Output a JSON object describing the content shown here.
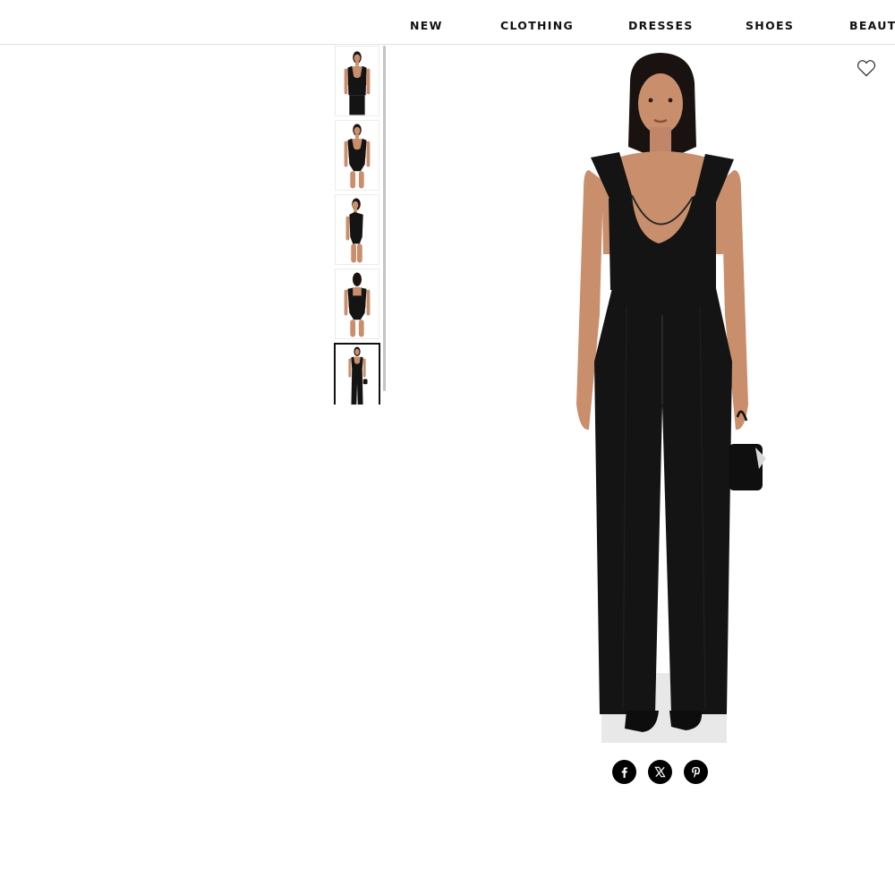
{
  "nav": {
    "items": [
      {
        "label": "NEW"
      },
      {
        "label": "CLOTHING"
      },
      {
        "label": "DRESSES"
      },
      {
        "label": "SHOES"
      },
      {
        "label": "BEAUTY"
      }
    ]
  },
  "gallery": {
    "thumbnails": [
      {
        "view": "front-upper",
        "selected": false
      },
      {
        "view": "front-bodysuit",
        "selected": false
      },
      {
        "view": "side-bodysuit",
        "selected": false
      },
      {
        "view": "back-bodysuit",
        "selected": false
      },
      {
        "view": "full-look",
        "selected": true
      }
    ],
    "main_image": {
      "icon": "product-photo"
    }
  },
  "actions": {
    "wishlist_icon": "heart-outline-icon"
  },
  "share": {
    "icons": [
      "facebook-icon",
      "x-icon",
      "pinterest-icon"
    ]
  },
  "colors": {
    "accent": "#111111",
    "skin": "#c98f6c",
    "garment": "#141414",
    "floor": "#e8e8e8"
  }
}
